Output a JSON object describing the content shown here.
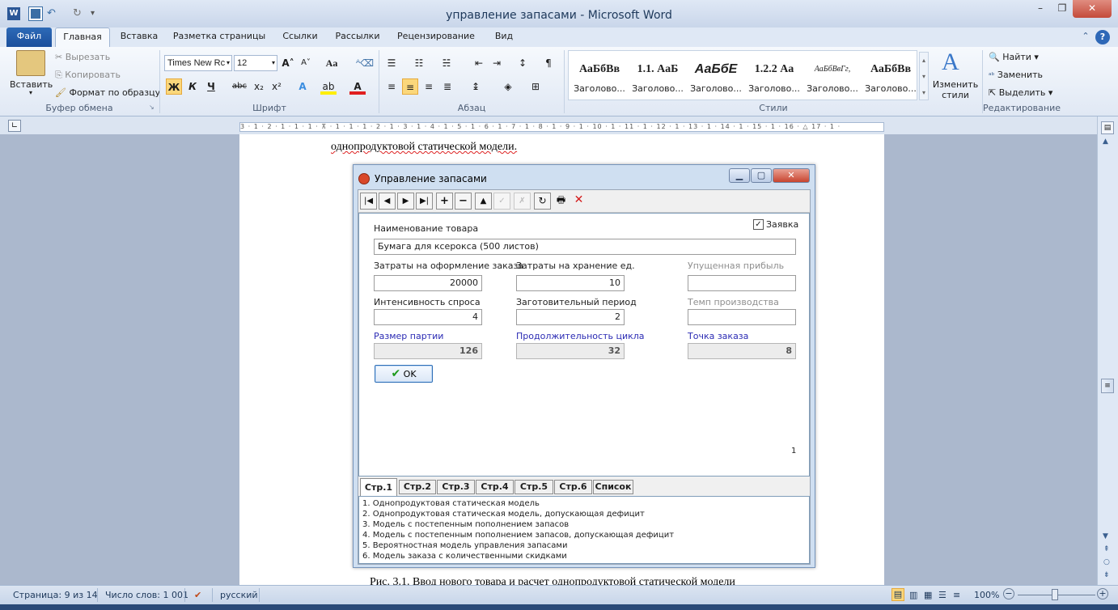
{
  "window": {
    "title": "управление запасами - Microsoft Word",
    "minimize": "–",
    "restore": "❐",
    "close": "✕"
  },
  "ribbon_tabs": [
    "Файл",
    "Главная",
    "Вставка",
    "Разметка страницы",
    "Ссылки",
    "Рассылки",
    "Рецензирование",
    "Вид"
  ],
  "clipboard": {
    "paste": "Вставить",
    "cut": "Вырезать",
    "copy": "Копировать",
    "format_painter": "Формат по образцу",
    "group": "Буфер обмена"
  },
  "font": {
    "name": "Times New Rc",
    "size": "12",
    "group": "Шрифт"
  },
  "paragraph": {
    "group": "Абзац"
  },
  "styles": {
    "items": [
      {
        "preview": "АаБбВв",
        "label": "Заголово..."
      },
      {
        "preview": "1.1. АаБ",
        "label": "Заголово..."
      },
      {
        "preview": "АаБбЕ",
        "label": "Заголово..."
      },
      {
        "preview": "1.2.2 Аа",
        "label": "Заголово..."
      },
      {
        "preview": "АаБбВвГг,",
        "label": "Заголово..."
      },
      {
        "preview": "АаБбВв",
        "label": "Заголово..."
      }
    ],
    "change": "Изменить стили",
    "group": "Стили"
  },
  "editing": {
    "find": "Найти",
    "replace": "Заменить",
    "select": "Выделить",
    "group": "Редактирование"
  },
  "ruler_text": "3 · 1 · 2 · 1 · 1 · 1 · ⊼ · 1 · 1 · 1 · 2 · 1 · 3 · 1 · 4 · 1 · 5 · 1 · 6 · 1 · 7 · 1 · 8 · 1 · 9 · 1 · 10 · 1 · 11 · 1 · 12 · 1 · 13 · 1 · 14 · 1 · 15 · 1 · 16 · △ 17 · 1 ·",
  "document": {
    "top_line": "однопродуктовой статической модели.",
    "caption": "Рис. 3.1. Ввод нового товара и расчет однопродуктовой статической модели"
  },
  "dialog": {
    "title": "Управление запасами",
    "toolbar": [
      "|◀",
      "◀",
      "▶",
      "▶|",
      "+",
      "−",
      "▲",
      "✓",
      "✗",
      "↻",
      "🖶",
      "✕"
    ],
    "product_name_label": "Наименование товара",
    "product_name_value": "Бумага для ксерокса (500 листов)",
    "request_checkbox_label": "Заявка",
    "request_checked": true,
    "order_cost_label": "Затраты на оформление заказа",
    "order_cost_value": "20000",
    "storage_cost_label": "Затраты на хранение ед.",
    "storage_cost_value": "10",
    "lost_profit_label": "Упущенная прибыль",
    "lost_profit_value": "",
    "demand_label": "Интенсивность спроса",
    "demand_value": "4",
    "lead_time_label": "Заготовительный период",
    "lead_time_value": "2",
    "production_rate_label": "Темп производства",
    "production_rate_value": "",
    "lot_size_label": "Размер партии",
    "lot_size_value": "126",
    "cycle_label": "Продолжительность цикла",
    "cycle_value": "32",
    "reorder_label": "Точка заказа",
    "reorder_value": "8",
    "ok_label": "OK",
    "record_number": "1",
    "tabs": [
      "Стр.1",
      "Стр.2",
      "Стр.3",
      "Стр.4",
      "Стр.5",
      "Стр.6",
      "Список"
    ],
    "models": [
      "1. Однопродуктовая статическая модель",
      "2. Однопродуктовая статическая модель, допускающая дефицит",
      "3. Модель с постепенным пополнением запасов",
      "4. Модель с постепенным пополнением запасов, допускающая дефицит",
      "5. Вероятностная модель управления запасами",
      "6. Модель заказа с количественными скидками"
    ]
  },
  "statusbar": {
    "page": "Страница: 9 из 14",
    "words": "Число слов: 1 001",
    "language": "русский",
    "zoom": "100%"
  },
  "colors": {
    "file_tab": "#1c4f9c",
    "highlight": "#fbd77b",
    "dialog_blue_label": "#2b2bb4"
  }
}
